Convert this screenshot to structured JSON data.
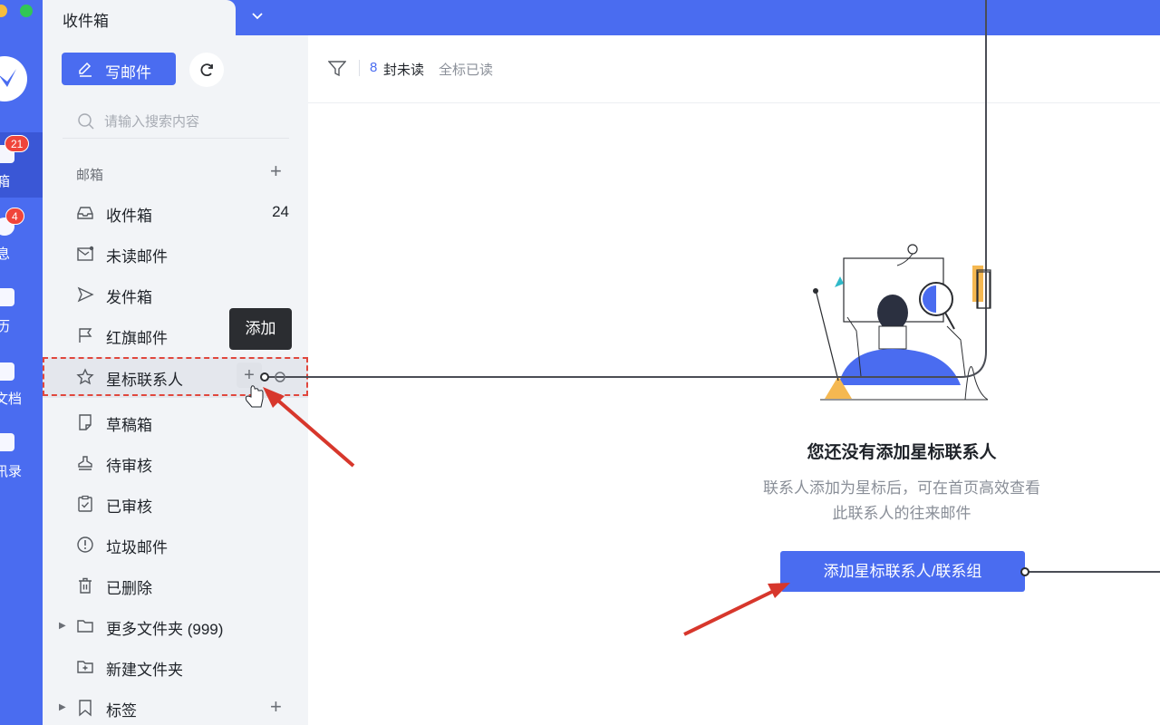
{
  "rail": {
    "badges": {
      "mail": "21",
      "messages": "4"
    },
    "items": [
      {
        "label": "箱",
        "icon": "mail-icon"
      },
      {
        "label": "息",
        "icon": "chat-icon"
      },
      {
        "label": "历",
        "icon": "calendar-icon"
      },
      {
        "label": "文档",
        "icon": "document-icon"
      },
      {
        "label": "讯录",
        "icon": "contacts-icon"
      }
    ]
  },
  "topbar": {
    "tab_title": "收件箱",
    "dropdown_icon": "chevron-down-icon"
  },
  "sidebar": {
    "compose_label": "写邮件",
    "search_placeholder": "请输入搜索内容",
    "section_title": "邮箱",
    "section_add": "+",
    "items": [
      {
        "label": "收件箱",
        "count": "24",
        "icon": "inbox-icon"
      },
      {
        "label": "未读邮件",
        "icon": "unread-mail-icon"
      },
      {
        "label": "发件箱",
        "icon": "send-icon"
      },
      {
        "label": "红旗邮件",
        "icon": "flag-icon"
      },
      {
        "label": "星标联系人",
        "icon": "star-icon"
      },
      {
        "label": "草稿箱",
        "icon": "draft-icon"
      },
      {
        "label": "待审核",
        "icon": "stamp-icon"
      },
      {
        "label": "已审核",
        "icon": "clipboard-check-icon"
      },
      {
        "label": "垃圾邮件",
        "icon": "spam-icon"
      },
      {
        "label": "已删除",
        "icon": "trash-icon"
      },
      {
        "label": "更多文件夹 (999)",
        "icon": "folder-icon"
      },
      {
        "label": "新建文件夹",
        "icon": "folder-add-icon"
      },
      {
        "label": "标签",
        "icon": "bookmark-icon"
      }
    ],
    "hover_add": "+",
    "tags_add": "+"
  },
  "tooltip": {
    "text": "添加"
  },
  "toolbar": {
    "unread_count": "8",
    "unread_text": "封未读",
    "mark_all_read": "全标已读"
  },
  "empty_state": {
    "title": "您还没有添加星标联系人",
    "description_line1": "联系人添加为星标后，可在首页高效查看",
    "description_line2": "此联系人的往来邮件",
    "button_label": "添加星标联系人/联系组"
  },
  "colors": {
    "accent": "#4a6cf0",
    "sidebar_bg": "#f2f4f7",
    "badge": "#f0453b",
    "annotation_red": "#e0473d"
  }
}
